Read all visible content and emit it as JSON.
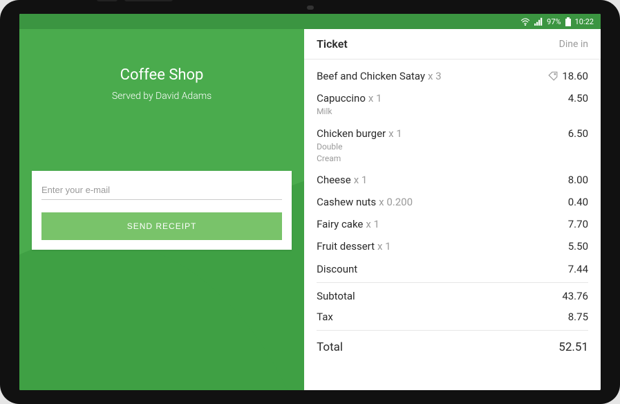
{
  "status": {
    "battery": "97%",
    "time": "10:22"
  },
  "left": {
    "shop_name": "Coffee Shop",
    "served_by": "Served by David Adams",
    "email_placeholder": "Enter your e-mail",
    "send_label": "SEND RECEIPT"
  },
  "ticket": {
    "title": "Ticket",
    "mode": "Dine in",
    "items": [
      {
        "name": "Beef and Chicken Satay",
        "qty": "x 3",
        "price": "18.60",
        "tag": true
      },
      {
        "name": "Capuccino",
        "qty": "x 1",
        "price": "4.50",
        "mods": [
          "Milk"
        ]
      },
      {
        "name": "Chicken burger",
        "qty": "x 1",
        "price": "6.50",
        "mods": [
          "Double",
          "Cream"
        ]
      },
      {
        "name": "Cheese",
        "qty": "x 1",
        "price": "8.00"
      },
      {
        "name": "Cashew nuts",
        "qty": "x 0.200",
        "price": "0.40"
      },
      {
        "name": "Fairy cake",
        "qty": "x 1",
        "price": "7.70"
      },
      {
        "name": "Fruit dessert",
        "qty": "x 1",
        "price": "5.50"
      }
    ],
    "discount_label": "Discount",
    "discount_value": "7.44",
    "subtotal_label": "Subtotal",
    "subtotal_value": "43.76",
    "tax_label": "Tax",
    "tax_value": "8.75",
    "total_label": "Total",
    "total_value": "52.51"
  }
}
